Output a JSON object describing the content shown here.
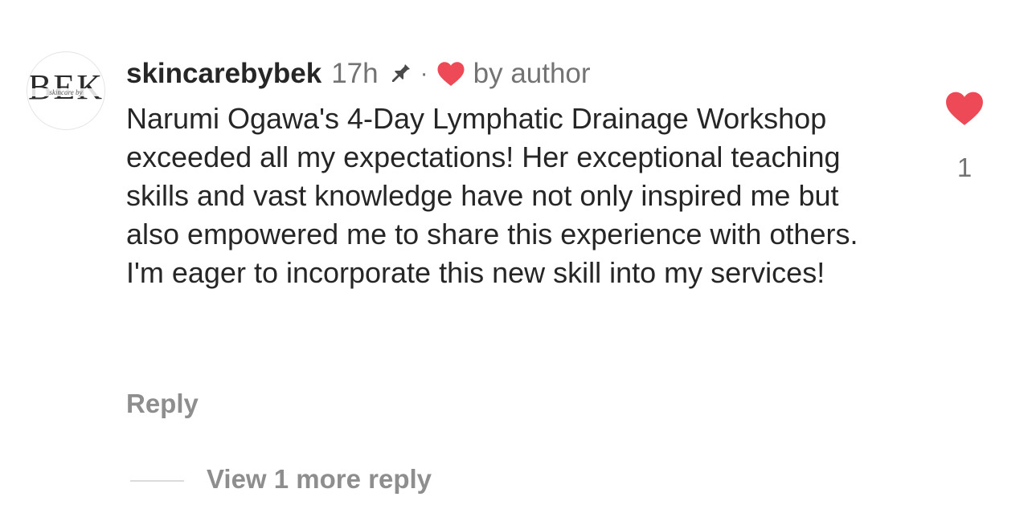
{
  "comment": {
    "avatar": {
      "mark": "BEK",
      "script": "skincare by"
    },
    "username": "skincarebybek",
    "time": "17h",
    "separator": "·",
    "liked_by_author_label": "by author",
    "text": "Narumi Ogawa's 4-Day Lymphatic Drainage Workshop exceeded all my expectations! Her exceptional teaching skills and vast knowledge have not only inspired me but also empowered me to share this experience with others. I'm eager to incorporate this new skill into my services!",
    "reply_label": "Reply",
    "like_count": "1",
    "view_replies_label": "View 1 more reply"
  },
  "icons": {
    "pin": "pin-icon",
    "author_heart": "heart-icon",
    "like": "heart-icon"
  },
  "colors": {
    "heart": "#ed4956",
    "text": "#262626",
    "secondary": "#737373",
    "muted": "#8e8e8e"
  }
}
